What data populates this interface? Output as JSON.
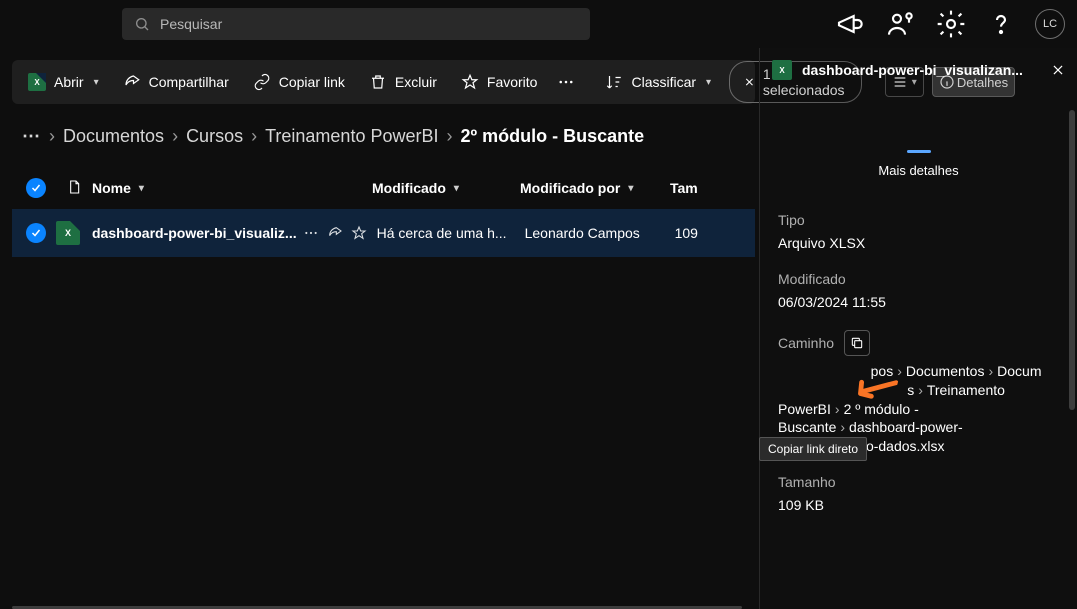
{
  "search": {
    "placeholder": "Pesquisar"
  },
  "avatar": "LC",
  "toolbar": {
    "open": "Abrir",
    "share": "Compartilhar",
    "copy_link": "Copiar link",
    "delete": "Excluir",
    "favorite": "Favorito",
    "sort": "Classificar",
    "selected": "1 selecionados",
    "details": "Detalhes"
  },
  "breadcrumbs": [
    "Documentos",
    "Cursos",
    "Treinamento PowerBI",
    "2º módulo - Buscante"
  ],
  "columns": {
    "name": "Nome",
    "modified": "Modificado",
    "modified_by": "Modificado por",
    "size": "Tam"
  },
  "rows": [
    {
      "name": "dashboard-power-bi_visualiz...",
      "modified": "Há cerca de uma h...",
      "modified_by": "Leonardo Campos",
      "size": "109"
    }
  ],
  "details": {
    "title": "dashboard-power-bi_visualizan...",
    "tab": "Mais detalhes",
    "type_label": "Tipo",
    "type_value": "Arquivo XLSX",
    "modified_label": "Modificado",
    "modified_value": "06/03/2024 11:55",
    "path_label": "Caminho",
    "path_segments": [
      "pos",
      "Documentos",
      "Docum",
      "s",
      "Treinamento PowerBI",
      "2 º módulo - Buscante",
      "dashboard-power-bi_visualizando-dados.xlsx"
    ],
    "size_label": "Tamanho",
    "size_value": "109 KB"
  },
  "tooltip": "Copiar link direto",
  "icons": {
    "xl": "X",
    "xl_sm": "X"
  }
}
